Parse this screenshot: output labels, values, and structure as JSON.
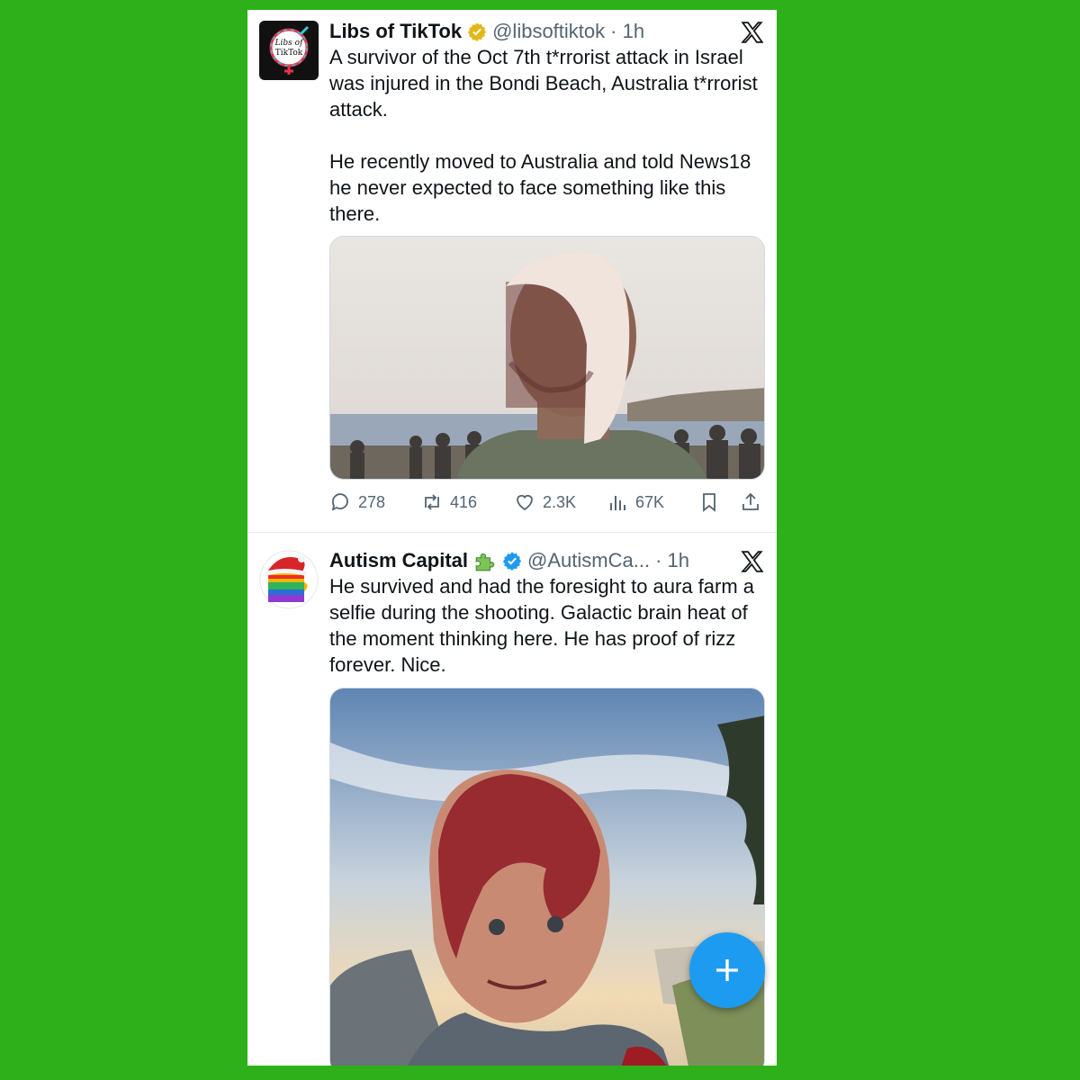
{
  "tweets": [
    {
      "display_name": "Libs of TikTok",
      "handle": "@libsoftiktok",
      "time": "· 1h",
      "avatar_text": "Libs of TikTok",
      "badge_color": "#e2b719",
      "text": "A survivor of the Oct 7th t*rrorist attack in Israel was injured in the Bondi Beach, Australia t*rrorist attack.\n\nHe recently moved to Australia and told News18 he never expected to face something like this there.",
      "media_icon": "photo-injured-man-beach",
      "stats": {
        "replies": "278",
        "reposts": "416",
        "likes": "2.3K",
        "views": "67K"
      }
    },
    {
      "display_name": "Autism Capital",
      "handle": "@AutismCa...",
      "time": "· 1h",
      "emoji_icon": "puzzle-piece-icon",
      "badge_color": "#1d9bf0",
      "text": "He survived and had the foresight to aura farm a selfie during the shooting. Galactic brain heat of the moment thinking here. He has proof of rizz forever. Nice.",
      "media_icon": "photo-bloodied-selfie"
    }
  ],
  "fab": {
    "icon": "plus-icon"
  },
  "colors": {
    "background": "#2eb01a",
    "accent": "#1d9bf0",
    "muted": "#536471"
  }
}
